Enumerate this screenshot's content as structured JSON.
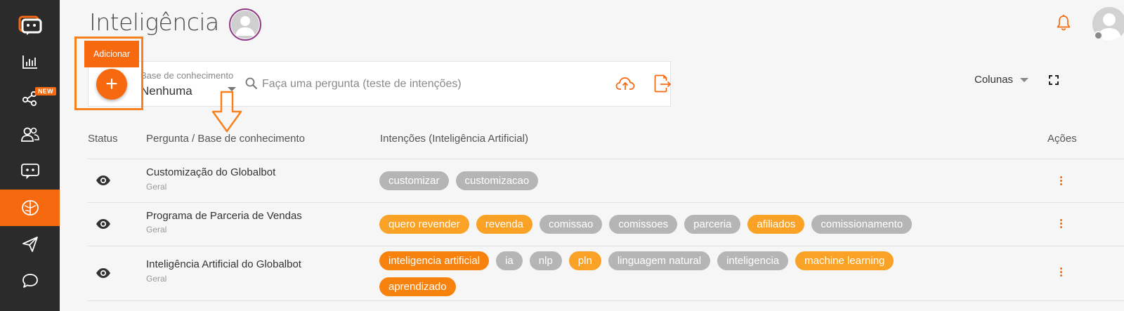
{
  "sidebar": {
    "items": [
      {
        "name": "logo",
        "icon": "chatbot-logo-icon"
      },
      {
        "name": "reports",
        "icon": "bar-chart-icon"
      },
      {
        "name": "integrations",
        "icon": "share-nodes-icon",
        "badge": "NEW"
      },
      {
        "name": "users",
        "icon": "users-icon"
      },
      {
        "name": "bots",
        "icon": "chat-bot-icon"
      },
      {
        "name": "intelligence",
        "icon": "brain-icon",
        "active": true
      },
      {
        "name": "send",
        "icon": "paper-plane-icon"
      },
      {
        "name": "chat",
        "icon": "chat-bubble-icon"
      }
    ]
  },
  "header": {
    "title": "Inteligência"
  },
  "toolbar": {
    "add_tooltip": "Adicionar",
    "add_symbol": "+",
    "kb_label": "Base de conhecimento",
    "kb_value": "Nenhuma",
    "search_placeholder": "Faça uma pergunta (teste de intenções)",
    "columns_label": "Colunas"
  },
  "table": {
    "headers": {
      "status": "Status",
      "question": "Pergunta / Base de conhecimento",
      "intents": "Intenções (Inteligência Artificial)",
      "actions": "Ações"
    },
    "rows": [
      {
        "title": "Customização do Globalbot",
        "base": "Geral",
        "intents": [
          {
            "label": "customizar",
            "style": "grey"
          },
          {
            "label": "customizacao",
            "style": "grey"
          }
        ]
      },
      {
        "title": "Programa de Parceria de Vendas",
        "base": "Geral",
        "intents": [
          {
            "label": "quero revender",
            "style": "orange"
          },
          {
            "label": "revenda",
            "style": "orange"
          },
          {
            "label": "comissao",
            "style": "grey"
          },
          {
            "label": "comissoes",
            "style": "grey"
          },
          {
            "label": "parceria",
            "style": "grey"
          },
          {
            "label": "afiliados",
            "style": "orange"
          },
          {
            "label": "comissionamento",
            "style": "grey"
          }
        ]
      },
      {
        "title": "Inteligência Artificial do Globalbot",
        "base": "Geral",
        "intents": [
          {
            "label": "inteligencia artificial",
            "style": "dark"
          },
          {
            "label": "ia",
            "style": "grey"
          },
          {
            "label": "nlp",
            "style": "grey"
          },
          {
            "label": "pln",
            "style": "orange"
          },
          {
            "label": "linguagem natural",
            "style": "grey"
          },
          {
            "label": "inteligencia",
            "style": "grey"
          },
          {
            "label": "machine learning",
            "style": "orange"
          },
          {
            "label": "aprendizado",
            "style": "dark"
          }
        ]
      }
    ]
  },
  "colors": {
    "accent": "#f7690f",
    "sidebar_bg": "#2b2b2b",
    "chip_grey": "#b5b5b5",
    "chip_orange": "#f9a225",
    "chip_dark_orange": "#f7820e"
  }
}
